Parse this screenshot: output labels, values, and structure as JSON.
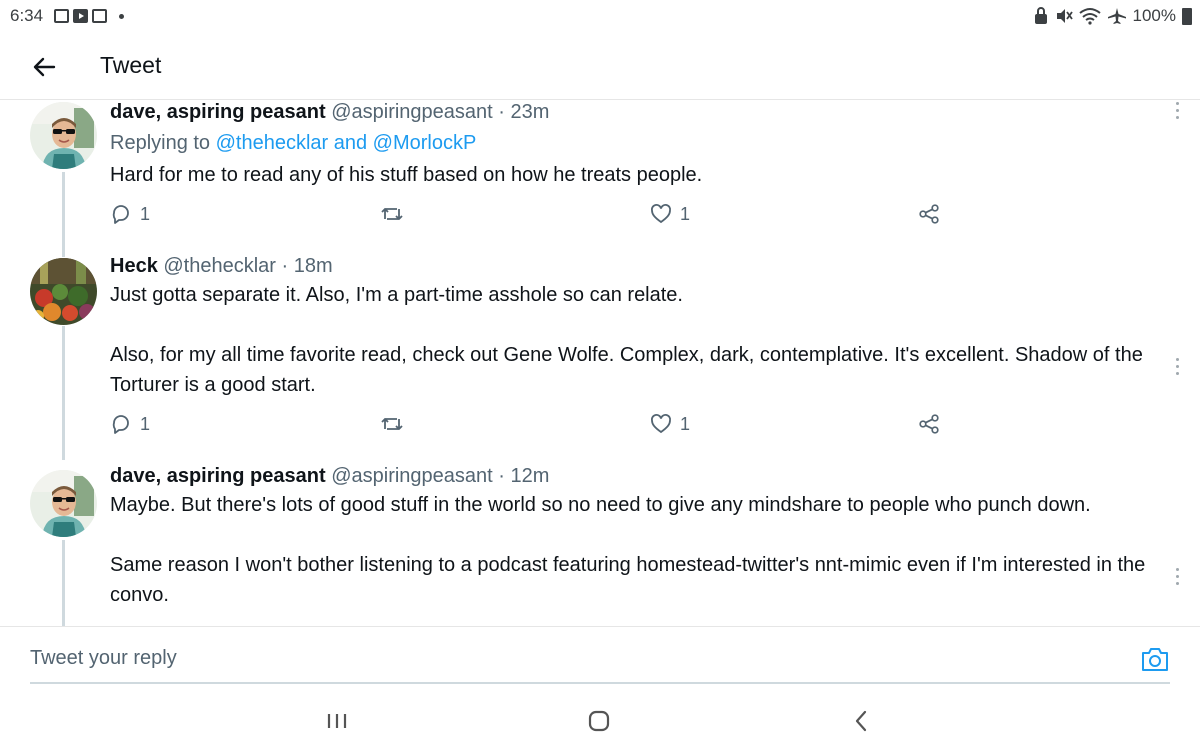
{
  "status_bar": {
    "time": "6:34",
    "battery": "100%"
  },
  "header": {
    "title": "Tweet"
  },
  "tweets": [
    {
      "name": "dave, aspiring peasant",
      "handle": "@aspiringpeasant",
      "time": "· 23m",
      "replying_prefix": "Replying to",
      "replying_to": "@thehecklar and @MorlockP",
      "text": [
        "Hard for me to read any of his stuff based on how he treats people."
      ],
      "reply_count": "1",
      "retweet_count": "",
      "like_count": "1"
    },
    {
      "name": "Heck",
      "handle": "@thehecklar",
      "time": "· 18m",
      "text": [
        "Just gotta separate it. Also, I'm a part-time asshole so can relate.",
        "Also, for my all time favorite read, check out Gene Wolfe. Complex, dark, contemplative. It's excellent. Shadow of the Torturer is a good start."
      ],
      "reply_count": "1",
      "retweet_count": "",
      "like_count": "1"
    },
    {
      "name": "dave, aspiring peasant",
      "handle": "@aspiringpeasant",
      "time": "· 12m",
      "text": [
        "Maybe. But there's lots of good stuff in the world so no need to give any mindshare to people who punch down.",
        "Same reason I won't bother listening to a podcast featuring homestead-twitter's nnt-mimic even if I'm interested in the convo."
      ]
    }
  ],
  "reply_bar": {
    "placeholder": "Tweet your reply"
  },
  "colors": {
    "link": "#1d9bf0",
    "secondary_text": "#536471",
    "thread_line": "#cfd9de"
  }
}
